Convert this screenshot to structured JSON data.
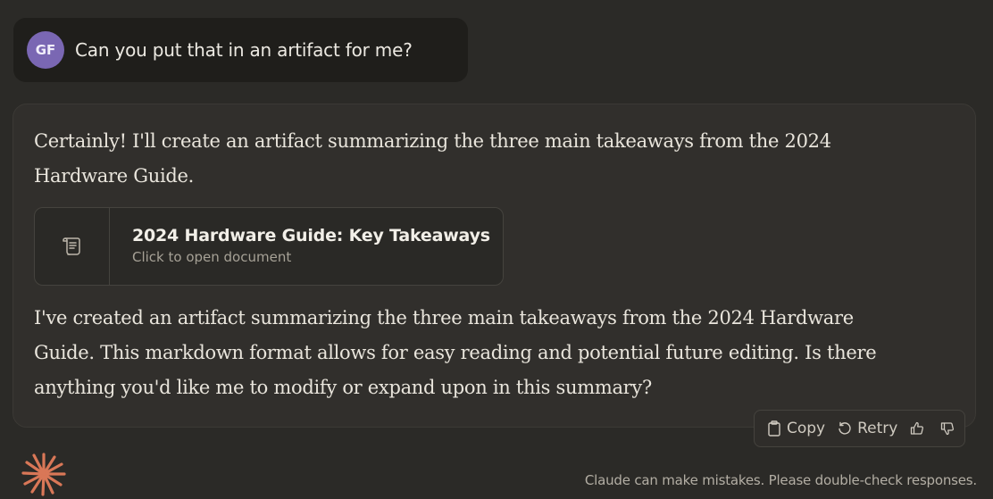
{
  "user_message": {
    "avatar_initials": "GF",
    "text": "Can you put that in an artifact for me?"
  },
  "assistant_message": {
    "paragraph_1": "Certainly! I'll create an artifact summarizing the three main takeaways from the 2024 Hardware Guide.",
    "artifact": {
      "icon": "document-icon",
      "title": "2024 Hardware Guide: Key Takeaways",
      "subtitle": "Click to open document"
    },
    "paragraph_2": "I've created an artifact summarizing the three main takeaways from the 2024 Hardware Guide. This markdown format allows for easy reading and potential future editing. Is there anything you'd like me to modify or expand upon in this summary?"
  },
  "actions": {
    "copy_label": "Copy",
    "retry_label": "Retry",
    "thumbs_up_icon": "thumbs-up-icon",
    "thumbs_down_icon": "thumbs-down-icon"
  },
  "footer": {
    "disclaimer": "Claude can make mistakes. Please double-check responses."
  },
  "colors": {
    "background": "#2b2a27",
    "avatar": "#7a67b3",
    "logo": "#d97757"
  }
}
